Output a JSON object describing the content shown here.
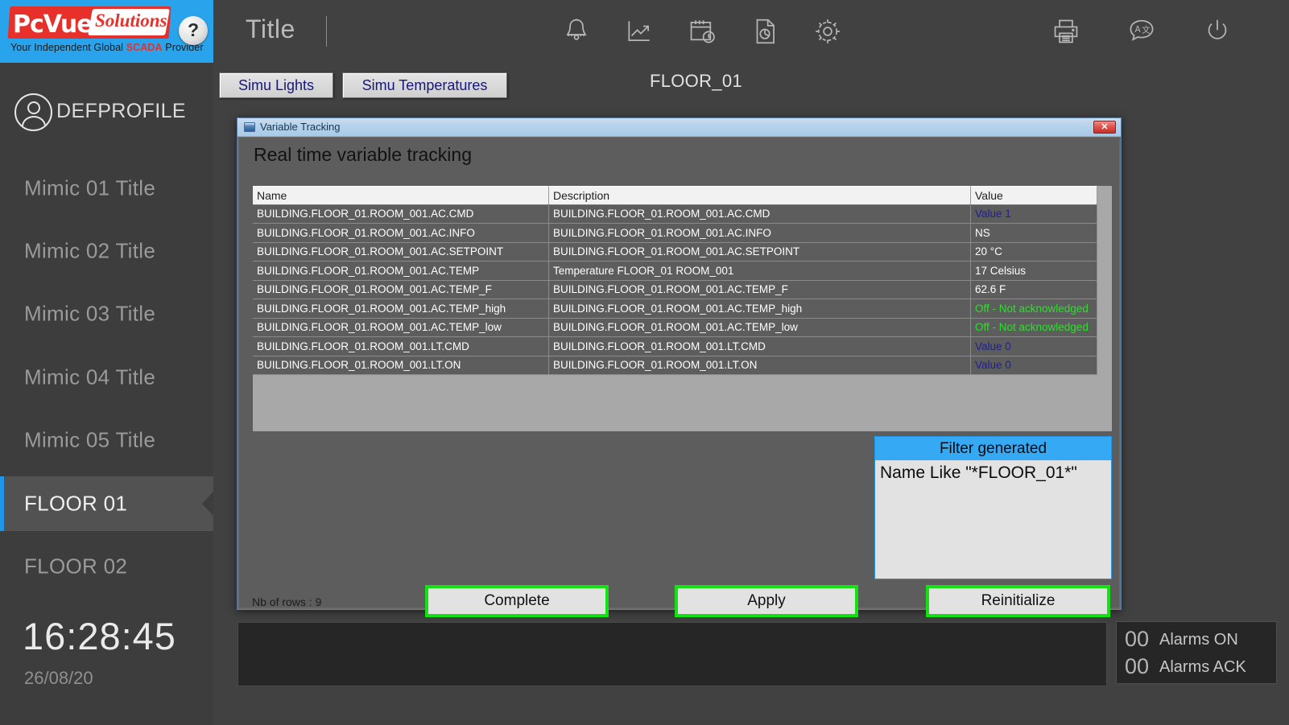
{
  "brand": {
    "name_pc": "PcVue",
    "registered": "®",
    "solutions": "Solutions",
    "tagline_pre": "Your Independent Global ",
    "tagline_bold": "SCADA",
    "tagline_post": " Provider",
    "help_label": "?",
    "logo_blue": "#29a3ec",
    "logo_red": "#e8302a"
  },
  "header": {
    "title": "Title",
    "icons": [
      {
        "name": "alarm-bell-icon",
        "label": "bell"
      },
      {
        "name": "trend-chart-icon",
        "label": "trend"
      },
      {
        "name": "calendar-clock-icon",
        "label": "scheduler"
      },
      {
        "name": "report-document-icon",
        "label": "report"
      },
      {
        "name": "gear-icon",
        "label": "settings"
      },
      {
        "name": "printer-icon",
        "label": "print"
      },
      {
        "name": "translate-icon",
        "label": "language"
      },
      {
        "name": "power-icon",
        "label": "power"
      }
    ]
  },
  "sidebar": {
    "profile_name": "DEFPROFILE",
    "items": [
      {
        "label": "Mimic 01 Title",
        "active": false
      },
      {
        "label": "Mimic 02 Title",
        "active": false
      },
      {
        "label": "Mimic 03 Title",
        "active": false
      },
      {
        "label": "Mimic 04 Title",
        "active": false
      },
      {
        "label": "Mimic 05 Title",
        "active": false
      },
      {
        "label": "FLOOR 01",
        "active": true
      },
      {
        "label": "FLOOR 02",
        "active": false
      }
    ],
    "clock": "16:28:45",
    "date": "26/08/20",
    "accent": "#2196e8"
  },
  "toolbar": {
    "tab_lights": "Simu Lights",
    "tab_temperatures": "Simu Temperatures",
    "page_heading": "FLOOR_01"
  },
  "dialog": {
    "window_title": "Variable Tracking",
    "close_label": "✕",
    "heading": "Real time variable tracking",
    "columns": [
      "Name",
      "Description",
      "Value"
    ],
    "rows": [
      {
        "name": "BUILDING.FLOOR_01.ROOM_001.AC.CMD",
        "description": "BUILDING.FLOOR_01.ROOM_001.AC.CMD",
        "value": "Value 1",
        "value_color": "blue"
      },
      {
        "name": "BUILDING.FLOOR_01.ROOM_001.AC.INFO",
        "description": "BUILDING.FLOOR_01.ROOM_001.AC.INFO",
        "value": "NS",
        "value_color": "white"
      },
      {
        "name": "BUILDING.FLOOR_01.ROOM_001.AC.SETPOINT",
        "description": "BUILDING.FLOOR_01.ROOM_001.AC.SETPOINT",
        "value": "20 °C",
        "value_color": "white"
      },
      {
        "name": "BUILDING.FLOOR_01.ROOM_001.AC.TEMP",
        "description": "Temperature FLOOR_01 ROOM_001",
        "value": "17 Celsius",
        "value_color": "white"
      },
      {
        "name": "BUILDING.FLOOR_01.ROOM_001.AC.TEMP_F",
        "description": "BUILDING.FLOOR_01.ROOM_001.AC.TEMP_F",
        "value": "62.6 F",
        "value_color": "white"
      },
      {
        "name": "BUILDING.FLOOR_01.ROOM_001.AC.TEMP_high",
        "description": "BUILDING.FLOOR_01.ROOM_001.AC.TEMP_high",
        "value": "Off - Not acknowledged",
        "value_color": "green"
      },
      {
        "name": "BUILDING.FLOOR_01.ROOM_001.AC.TEMP_low",
        "description": "BUILDING.FLOOR_01.ROOM_001.AC.TEMP_low",
        "value": "Off - Not acknowledged",
        "value_color": "green"
      },
      {
        "name": "BUILDING.FLOOR_01.ROOM_001.LT.CMD",
        "description": "BUILDING.FLOOR_01.ROOM_001.LT.CMD",
        "value": "Value 0",
        "value_color": "blue"
      },
      {
        "name": "BUILDING.FLOOR_01.ROOM_001.LT.ON",
        "description": "BUILDING.FLOOR_01.ROOM_001.LT.ON",
        "value": "Value 0",
        "value_color": "blue"
      }
    ],
    "filter_title": "Filter generated",
    "filter_expression": "Name Like \"*FLOOR_01*\"",
    "row_count_label": "Nb of rows : 9",
    "btn_complete": "Complete",
    "btn_apply": "Apply",
    "btn_reinitialize": "Reinitialize",
    "button_border_color": "#12e112"
  },
  "alarms": {
    "on_count": "00",
    "on_label": "Alarms ON",
    "ack_count": "00",
    "ack_label": "Alarms ACK"
  }
}
